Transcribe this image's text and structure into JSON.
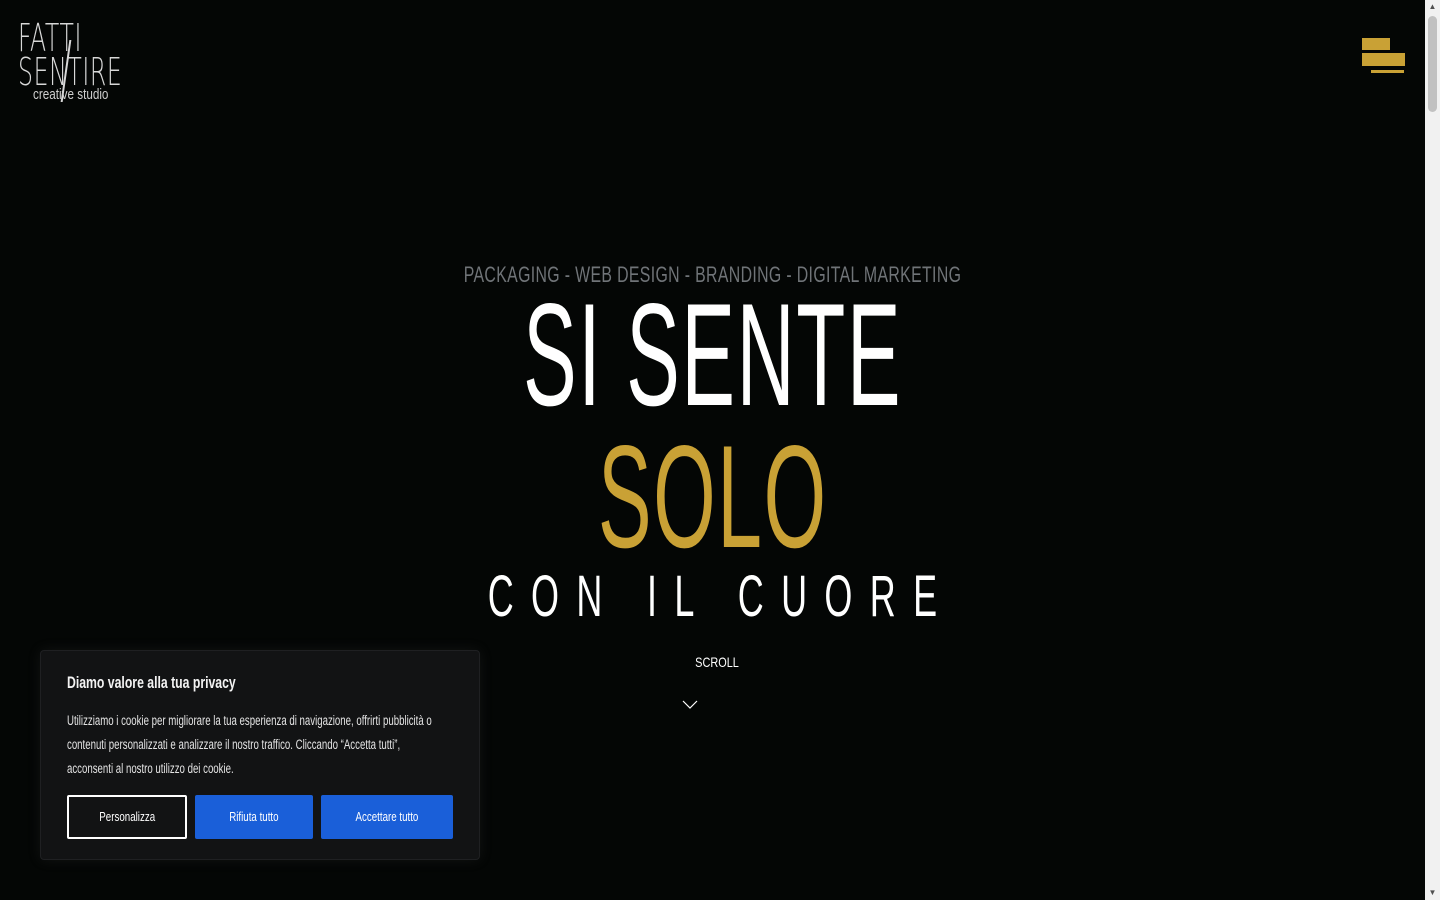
{
  "logo": {
    "line1": "FATTI",
    "line2": "SENTIRE",
    "line3": "creative studio"
  },
  "hero": {
    "services": "PACKAGING - WEB DESIGN - BRANDING - DIGITAL MARKETING",
    "line1": "SI SENTE",
    "line2": "SOLO",
    "line3": "CON IL CUORE",
    "scroll_label": "SCROLL"
  },
  "cookie_banner": {
    "title": "Diamo valore alla tua privacy",
    "text": "Utilizziamo i cookie per migliorare la tua esperienza di navigazione, offrirti pubblicità o contenuti personalizzati e analizzare il nostro traffico. Cliccando “Accetta tutti”, acconsenti al nostro utilizzo dei cookie.",
    "customize_label": "Personalizza",
    "reject_label": "Rifiuta tutto",
    "accept_label": "Accettare tutto"
  },
  "icons": {
    "menu": "hamburger-menu-icon",
    "scroll": "chevron-down-icon"
  },
  "colors": {
    "background": "#040605",
    "accent_gold": "#c9a135",
    "button_blue": "#1a5fd9",
    "services_gray": "#707478"
  }
}
